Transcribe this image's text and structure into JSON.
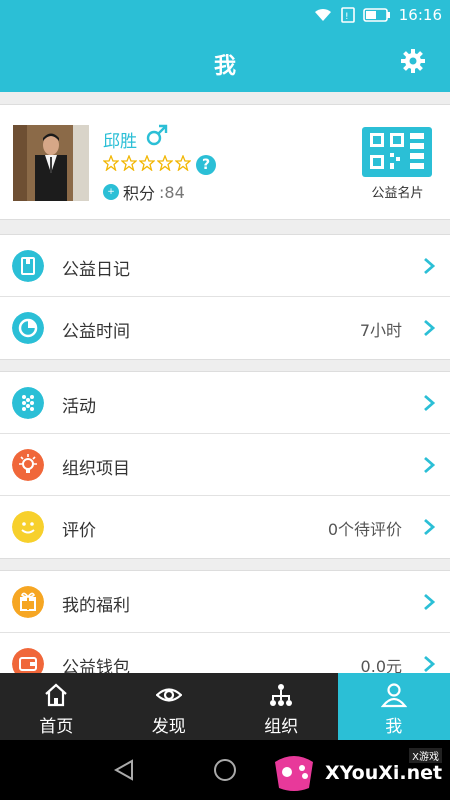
{
  "status_bar": {
    "time": "16:16"
  },
  "header": {
    "title": "我",
    "settings_icon": "gear-icon"
  },
  "profile": {
    "name": "邱胜",
    "gender_icon": "male-icon",
    "rating_stars": 0,
    "max_stars": 5,
    "points_label": "积分",
    "points_value": ":84",
    "card_label": "公益名片"
  },
  "menu_groups": [
    {
      "items": [
        {
          "label": "公益日记",
          "value": "",
          "icon": "diary-icon",
          "color": "#2bbfd6"
        },
        {
          "label": "公益时间",
          "value": "7小时",
          "icon": "clock-icon",
          "color": "#2bbfd6"
        }
      ]
    },
    {
      "items": [
        {
          "label": "活动",
          "value": "",
          "icon": "activity-icon",
          "color": "#2bbfd6"
        },
        {
          "label": "组织项目",
          "value": "",
          "icon": "lightbulb-icon",
          "color": "#f0673a"
        },
        {
          "label": "评价",
          "value": "0个待评价",
          "icon": "smile-icon",
          "color": "#f7d02c"
        }
      ]
    },
    {
      "items": [
        {
          "label": "我的福利",
          "value": "",
          "icon": "gift-icon",
          "color": "#f6a623"
        },
        {
          "label": "公益钱包",
          "value": "0.0元",
          "icon": "wallet-icon",
          "color": "#f0673a"
        }
      ]
    }
  ],
  "tabs": [
    {
      "label": "首页",
      "icon": "home-icon",
      "active": false
    },
    {
      "label": "发现",
      "icon": "eye-icon",
      "active": false
    },
    {
      "label": "组织",
      "icon": "org-icon",
      "active": false
    },
    {
      "label": "我",
      "icon": "user-icon",
      "active": true
    }
  ],
  "watermark": {
    "text": "XYouXi.net",
    "tag": "X游戏"
  },
  "colors": {
    "accent": "#2bbfd6",
    "tabbar": "#252525",
    "star": "#f2b705"
  }
}
